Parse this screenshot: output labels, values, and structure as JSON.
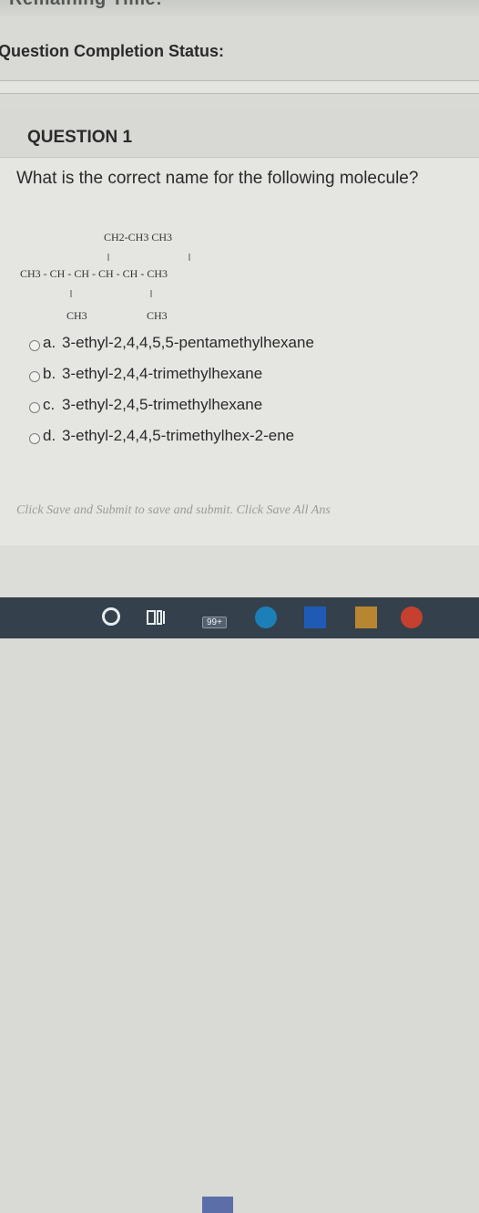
{
  "top_banner": {
    "text": "Remaining Time:"
  },
  "status": {
    "label": "Question Completion Status:"
  },
  "question": {
    "title": "QUESTION 1",
    "prompt": "What is the correct name for the following molecule?",
    "molecule": {
      "top_branch": "CH2-CH3  CH3",
      "main_chain": "CH3 - CH - CH - CH - CH - CH3",
      "bottom_left": "CH3",
      "bottom_right": "CH3"
    },
    "options": [
      {
        "letter": "a.",
        "text": "3-ethyl-2,4,4,5,5-pentamethylhexane"
      },
      {
        "letter": "b.",
        "text": "3-ethyl-2,4,4-trimethylhexane"
      },
      {
        "letter": "c.",
        "text": "3-ethyl-2,4,5-trimethylhexane"
      },
      {
        "letter": "d.",
        "text": "3-ethyl-2,4,4,5-trimethylhex-2-ene"
      }
    ]
  },
  "footer": {
    "save_text": "Click Save and Submit to save and submit. Click Save All Ans"
  },
  "taskbar": {
    "badge": "99+",
    "icons": [
      "cortana-icon",
      "task-view-icon",
      "app-icon",
      "edge-icon",
      "outlook-icon",
      "files-icon",
      "chrome-icon"
    ]
  }
}
